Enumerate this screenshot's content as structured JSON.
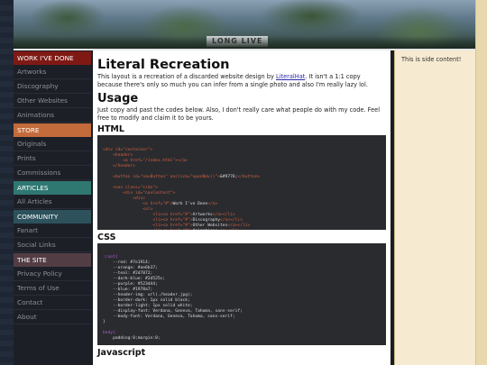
{
  "header": {
    "sign_text": "LONG LIVE"
  },
  "nav": {
    "sections": [
      {
        "title": "WORK I'VE DONE",
        "color": "#7e1914",
        "items": [
          "Artworks",
          "Discography",
          "Other Websites",
          "Animations"
        ]
      },
      {
        "title": "STORE",
        "color": "#c36b3a",
        "items": [
          "Originals",
          "Prints",
          "Commissions"
        ]
      },
      {
        "title": "ARTICLES",
        "color": "#2f7872",
        "items": [
          "All Articles"
        ]
      },
      {
        "title": "COMMUNITY",
        "color": "#2d525c",
        "items": [
          "Fanart",
          "Social Links"
        ]
      },
      {
        "title": "THE SITE",
        "color": "#523d44",
        "items": [
          "Privacy Policy",
          "Terms of Use",
          "Contact",
          "About"
        ]
      }
    ]
  },
  "main": {
    "title": "Literal Recreation",
    "intro_before_link": "This layout is a recreation of a discarded website design by ",
    "intro_link": "LiteralHat",
    "intro_after_link": ". It isn't a 1:1 copy because there's only so much you can infer from a single photo and also I'm really lazy lol.",
    "usage_heading": "Usage",
    "usage_text": "Just copy and past the codes below. Also, I don't really care what people do with my code. Feel free to modify and claim it to be yours.",
    "html_heading": "HTML",
    "css_heading": "CSS",
    "js_heading": "Javascript"
  },
  "code_html": [
    "<div id=\"container\">",
    "    <header>",
    "        <a href=\"/index.html\"></a>",
    "    </header>",
    "",
    "    <button id=\"navButton\" onclick=\"openNav()\">&#9776;</button>",
    "",
    "    <nav class=\"side\">",
    "        <div id=\"navContent\">",
    "            <div>",
    "                <a href=\"#\">Work I've Done</a>",
    "                <ul>",
    "                    <li><a href=\"#\">Artworks</a></li>",
    "                    <li><a href=\"#\">Discography</a></li>",
    "                    <li><a href=\"#\">Other Websites</a></li>",
    "                    <li><a href=\"#\">Animations</a></li>"
  ],
  "code_css": [
    ":root{",
    "    --red: #7e1914;",
    "    --orange: #ae6b37;",
    "    --teal: #2d7872;",
    "    --dark-blue: #2d525c;",
    "    --purple: #523d44;",
    "    --blue: #1978a7;",
    "    --header-img: url(./header.jpg);",
    "    --border-dark: 1px solid black;",
    "    --border-light: 1px solid white;",
    "    --display-font: Verdana, Geneva, Tahoma, sans-serif;",
    "    --body-font: Verdana, Geneva, Tahoma, sans-serif;",
    "}",
    "",
    "body{",
    "    padding:0;margin:0;"
  ],
  "aside": {
    "text": "This is side content!"
  }
}
